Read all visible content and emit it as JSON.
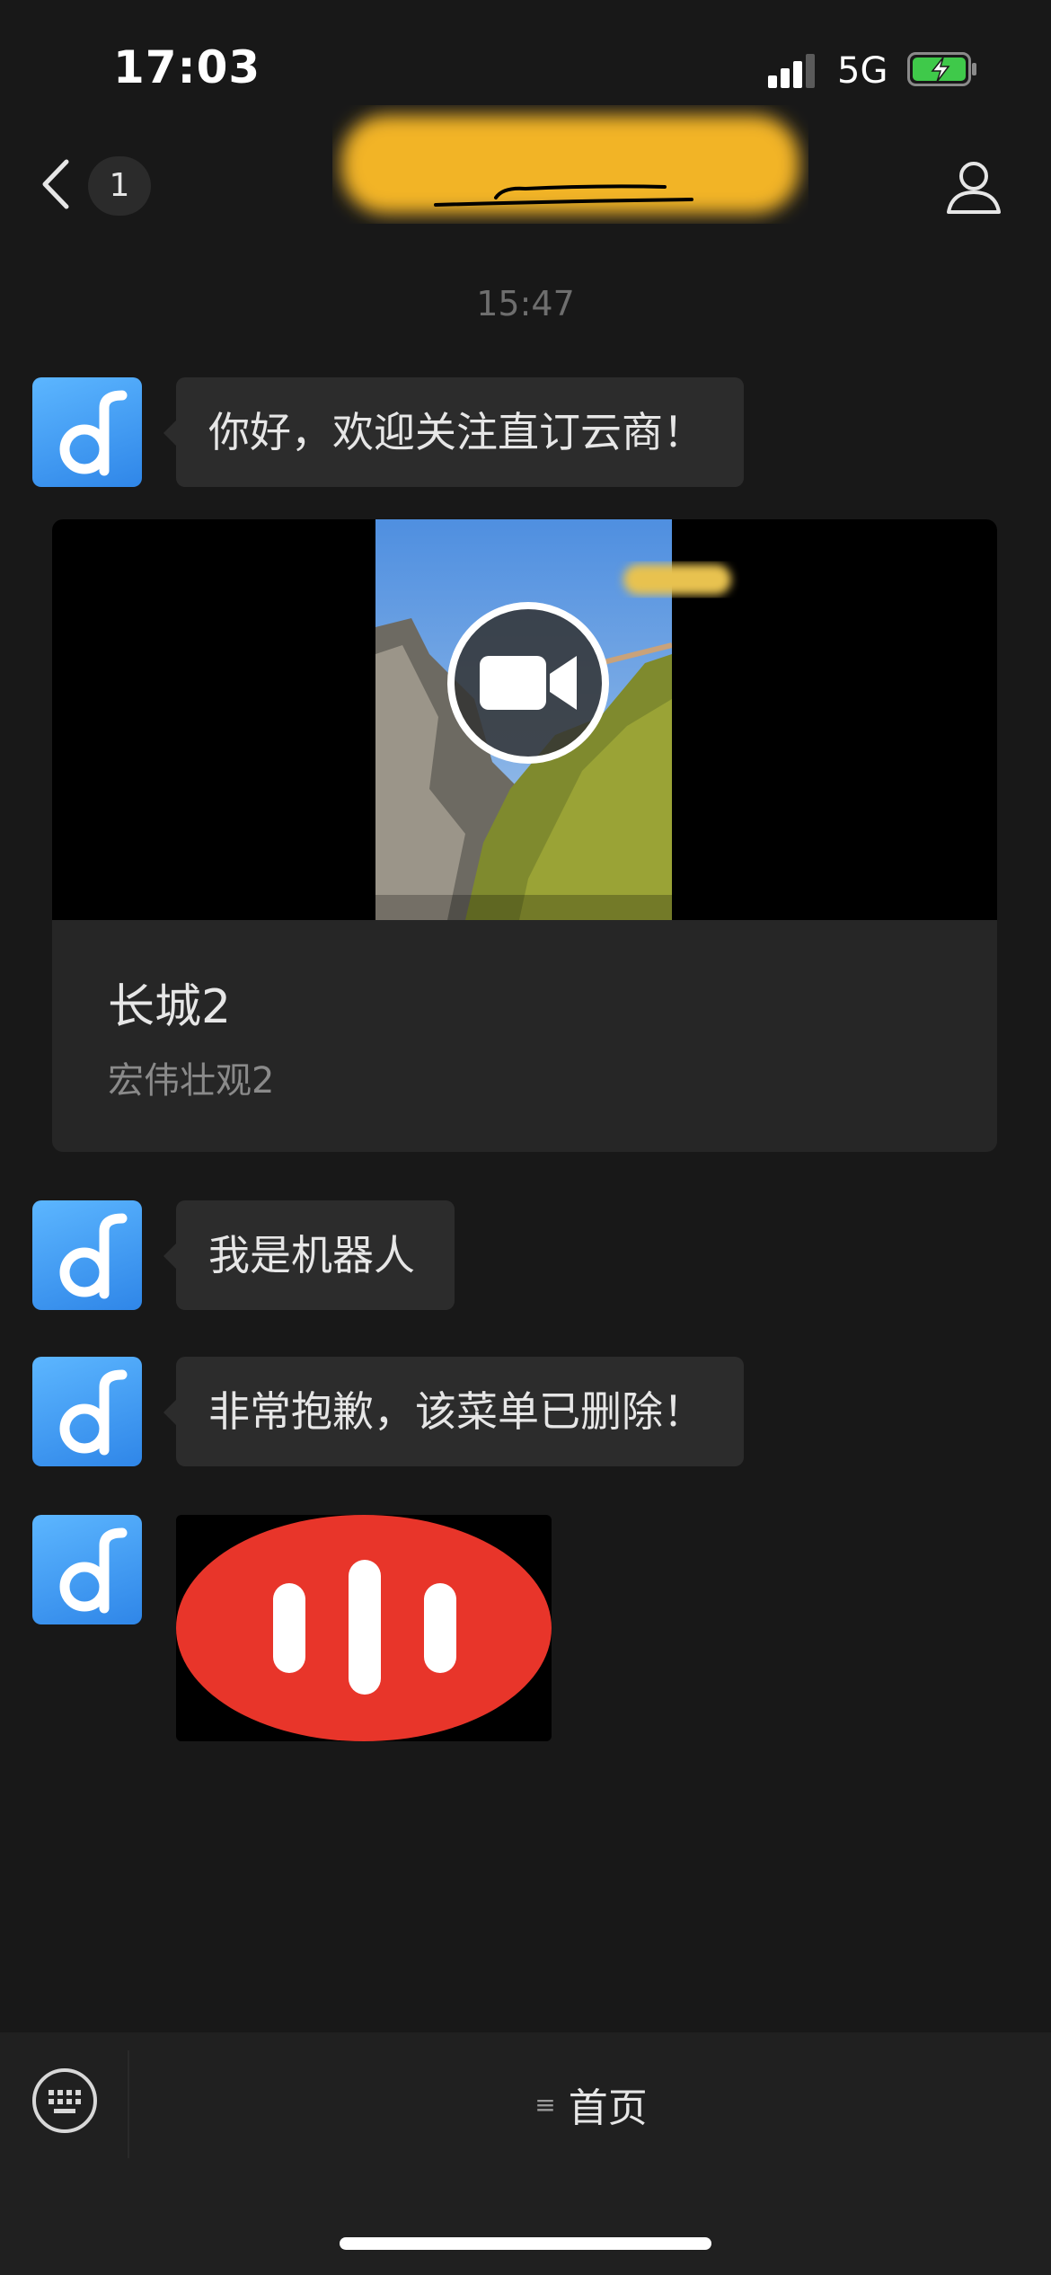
{
  "status_bar": {
    "time": "17:03",
    "network": "5G"
  },
  "nav": {
    "unread_count": "1"
  },
  "chat": {
    "timestamp": "15:47",
    "messages": [
      {
        "type": "text",
        "text": "你好，欢迎关注直订云商！"
      },
      {
        "type": "video_card",
        "title": "长城2",
        "description": "宏伟壮观2"
      },
      {
        "type": "text",
        "text": "我是机器人"
      },
      {
        "type": "text",
        "text": "非常抱歉，该菜单已删除！"
      },
      {
        "type": "sticker"
      }
    ]
  },
  "bottom_menu": {
    "items": [
      {
        "label": "首页"
      }
    ]
  },
  "colors": {
    "background": "#181818",
    "bubble": "#2c2c2c",
    "avatar_blue": "#3d95f0",
    "sticker_red": "#e8352a"
  }
}
